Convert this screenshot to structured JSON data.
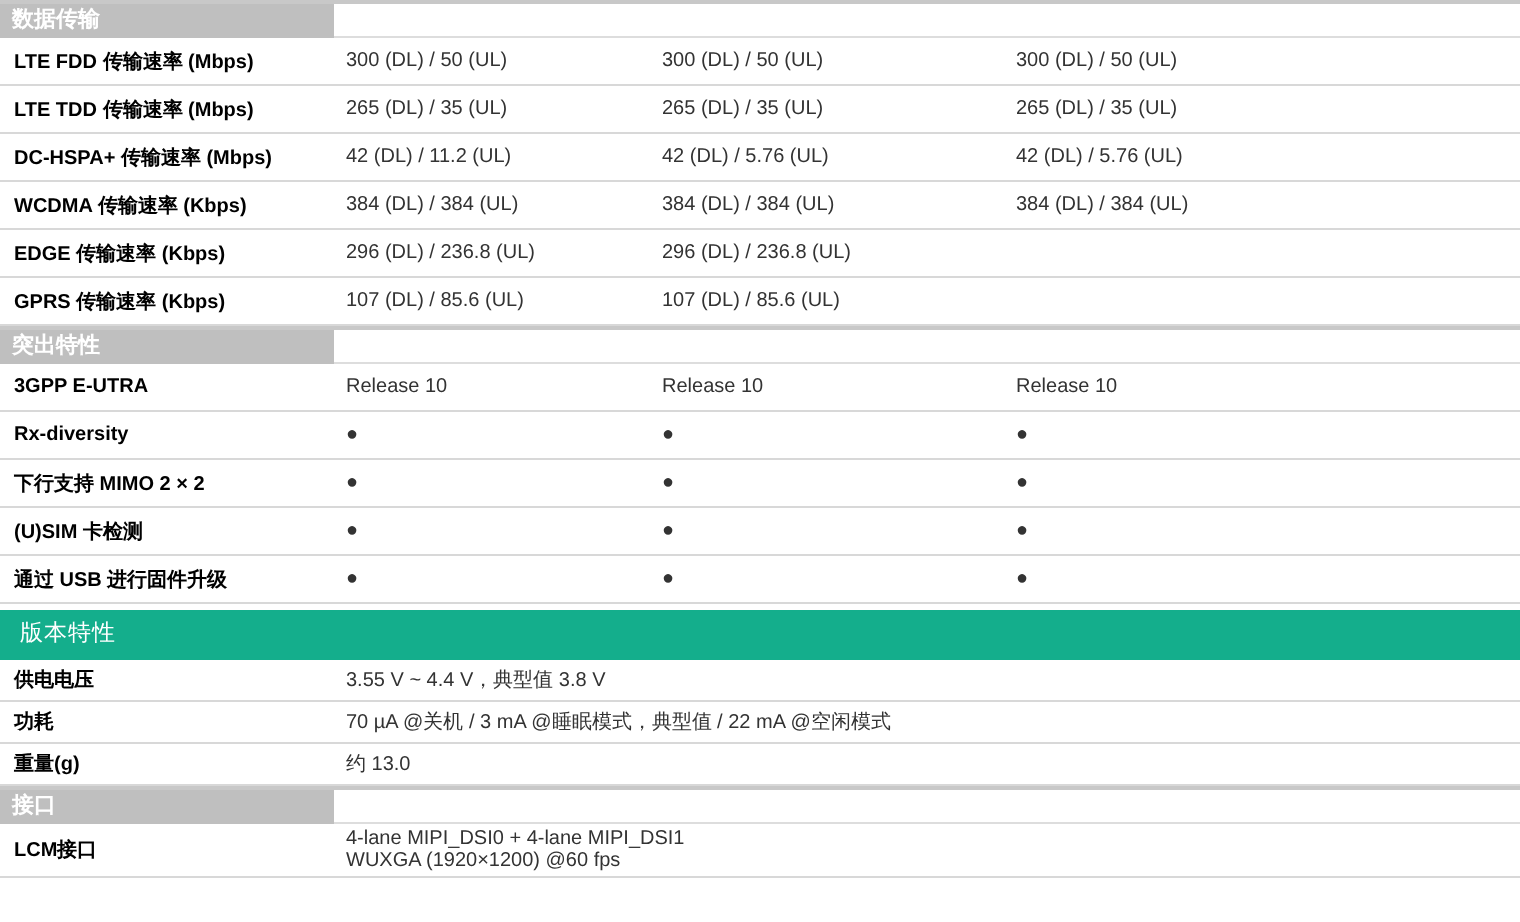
{
  "sections": [
    {
      "kind": "gray",
      "title": "数据传输",
      "rows": [
        {
          "label": "LTE FDD 传输速率 (Mbps)",
          "cells": [
            "300 (DL) / 50 (UL)",
            "300 (DL) / 50 (UL)",
            "300 (DL) / 50 (UL)"
          ]
        },
        {
          "label": "LTE TDD 传输速率 (Mbps)",
          "cells": [
            "265 (DL) / 35 (UL)",
            "265 (DL) / 35 (UL)",
            "265 (DL) / 35 (UL)"
          ]
        },
        {
          "label": "DC-HSPA+ 传输速率 (Mbps)",
          "cells": [
            "42 (DL) / 11.2 (UL)",
            "42 (DL) / 5.76 (UL)",
            "42 (DL) / 5.76 (UL)"
          ]
        },
        {
          "label": "WCDMA 传输速率 (Kbps)",
          "cells": [
            "384 (DL) / 384 (UL)",
            "384 (DL) / 384 (UL)",
            "384 (DL) / 384 (UL)"
          ]
        },
        {
          "label": "EDGE 传输速率 (Kbps)",
          "cells": [
            "296 (DL) / 236.8 (UL)",
            "296 (DL) / 236.8 (UL)"
          ]
        },
        {
          "label": "GPRS 传输速率 (Kbps)",
          "cells": [
            "107 (DL) / 85.6 (UL)",
            "107 (DL) / 85.6 (UL)"
          ]
        }
      ]
    },
    {
      "kind": "gray",
      "title": "突出特性",
      "rows": [
        {
          "label": "3GPP E-UTRA",
          "cells": [
            "Release 10",
            "Release 10",
            "Release 10"
          ]
        },
        {
          "label": "Rx-diversity",
          "cells": [
            "●",
            "●",
            "●"
          ]
        },
        {
          "label": "下行支持 MIMO 2 × 2",
          "cells": [
            "●",
            "●",
            "●"
          ]
        },
        {
          "label": "(U)SIM 卡检测",
          "cells": [
            "●",
            "●",
            "●"
          ]
        },
        {
          "label": "通过 USB 进行固件升级",
          "cells": [
            "●",
            "●",
            "●"
          ]
        }
      ]
    },
    {
      "kind": "green",
      "title": "版本特性",
      "rows": [
        {
          "label": "供电电压",
          "span": true,
          "cells": [
            "3.55 V ~ 4.4 V，典型值 3.8 V"
          ]
        },
        {
          "label": "功耗",
          "span": true,
          "cells": [
            "70 µA @关机 / 3 mA @睡眠模式，典型值 / 22 mA @空闲模式"
          ]
        },
        {
          "label": "重量(g)",
          "span": true,
          "cells": [
            "约 13.0"
          ]
        }
      ]
    },
    {
      "kind": "gray",
      "title": "接口",
      "rows": [
        {
          "label": "LCM接口",
          "span": true,
          "cells": [
            "4-lane MIPI_DSI0 + 4-lane MIPI_DSI1",
            "WUXGA (1920×1200) @60 fps"
          ]
        }
      ]
    }
  ]
}
